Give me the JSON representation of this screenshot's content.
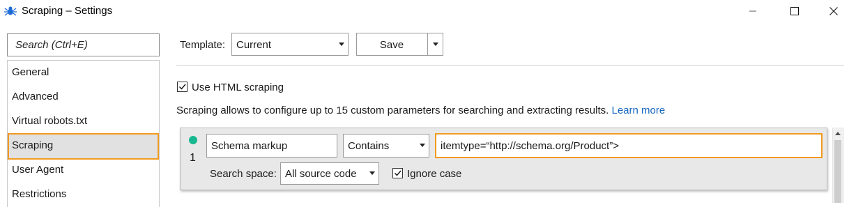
{
  "window": {
    "title": "Scraping – Settings",
    "icon": "spider-icon",
    "controls": [
      "minimize-icon",
      "maximize-icon",
      "close-icon"
    ]
  },
  "sidebar": {
    "search_placeholder": "Search (Ctrl+E)",
    "items": [
      {
        "label": "General"
      },
      {
        "label": "Advanced"
      },
      {
        "label": "Virtual robots.txt"
      },
      {
        "label": "Scraping",
        "active": true
      },
      {
        "label": "User Agent"
      },
      {
        "label": "Restrictions"
      }
    ]
  },
  "toolbar": {
    "template_label": "Template:",
    "template_value": "Current",
    "save_label": "Save"
  },
  "settings": {
    "use_html_scraping_label": "Use HTML scraping",
    "use_html_scraping_checked": true,
    "description": "Scraping allows to configure up to 15 custom parameters for searching and extracting results.",
    "learn_more": "Learn more"
  },
  "parameter": {
    "index": "1",
    "status_color": "#17b890",
    "name": "Schema markup",
    "condition": "Contains",
    "value": "itemtype=“http://schema.org/Product”>",
    "search_space_label": "Search space:",
    "search_space_value": "All source code",
    "ignore_case_label": "Ignore case",
    "ignore_case_checked": true
  },
  "colors": {
    "accent": "#f29a1f",
    "link": "#1565c0",
    "status": "#17b890"
  }
}
